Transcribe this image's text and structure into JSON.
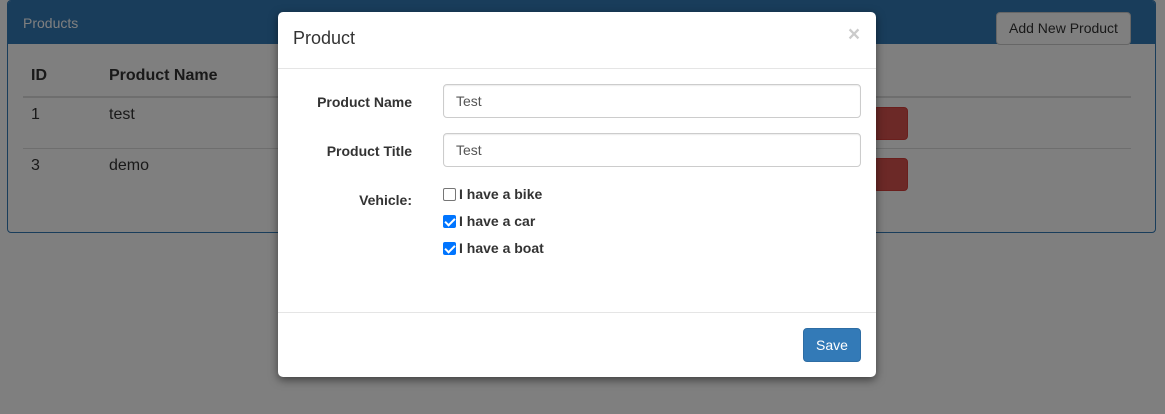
{
  "panel": {
    "title": "Products",
    "add_button_label": "Add New Product"
  },
  "table": {
    "headers": [
      "ID",
      "Product Name"
    ],
    "rows": [
      {
        "id": "1",
        "name": "test"
      },
      {
        "id": "3",
        "name": "demo"
      }
    ]
  },
  "modal": {
    "title": "Product",
    "close_label": "×",
    "fields": {
      "product_name": {
        "label": "Product Name",
        "value": "Test"
      },
      "product_title": {
        "label": "Product Title",
        "value": "Test"
      }
    },
    "vehicle": {
      "label": "Vehicle:",
      "options": [
        {
          "label": "I have a bike",
          "checked": false
        },
        {
          "label": "I have a car",
          "checked": true
        },
        {
          "label": "I have a boat",
          "checked": true
        }
      ]
    },
    "save_label": "Save"
  },
  "colors": {
    "primary": "#337ab7",
    "danger": "#d9534f",
    "checkbox_checked": "#0075ff"
  }
}
